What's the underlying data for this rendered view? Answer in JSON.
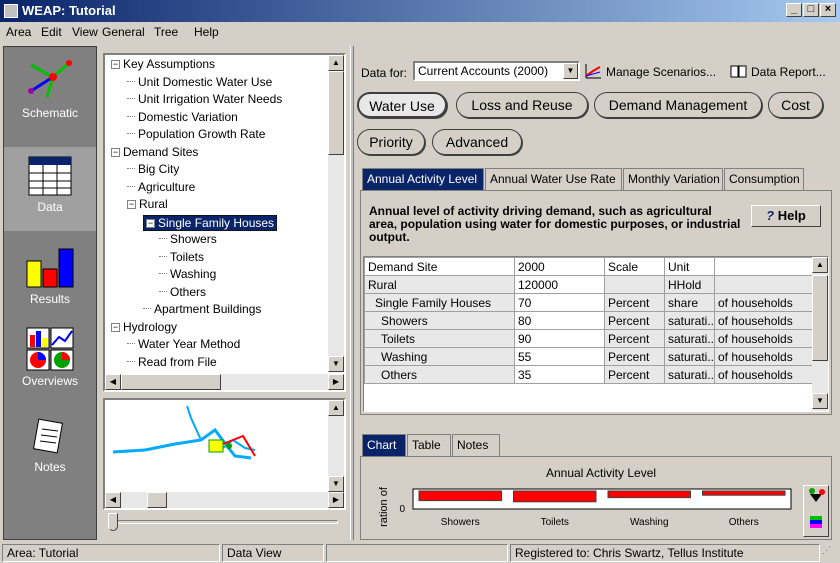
{
  "window": {
    "title": "WEAP: Tutorial"
  },
  "menu": [
    "Area",
    "Edit",
    "View",
    "General",
    "Tree",
    "Help"
  ],
  "nav": [
    {
      "label": "Schematic",
      "icon": "schematic-icon"
    },
    {
      "label": "Data",
      "icon": "data-icon"
    },
    {
      "label": "Results",
      "icon": "results-icon"
    },
    {
      "label": "Overviews",
      "icon": "overviews-icon"
    },
    {
      "label": "Notes",
      "icon": "notes-icon"
    }
  ],
  "tree": {
    "nodes": [
      {
        "label": "Key Assumptions",
        "expander": "−"
      },
      {
        "label": "Unit Domestic Water Use"
      },
      {
        "label": "Unit Irrigation Water Needs"
      },
      {
        "label": "Domestic Variation"
      },
      {
        "label": "Population Growth Rate"
      },
      {
        "label": "Demand Sites",
        "expander": "−"
      },
      {
        "label": "Big City"
      },
      {
        "label": "Agriculture"
      },
      {
        "label": "Rural",
        "expander": "−"
      },
      {
        "label": "Single Family Houses",
        "expander": "−",
        "selected": true
      },
      {
        "label": "Showers"
      },
      {
        "label": "Toilets"
      },
      {
        "label": "Washing"
      },
      {
        "label": "Others"
      },
      {
        "label": "Apartment Buildings"
      },
      {
        "label": "Hydrology",
        "expander": "−"
      },
      {
        "label": "Water Year Method"
      },
      {
        "label": "Read from File"
      }
    ]
  },
  "toolbar": {
    "data_for_label": "Data for:",
    "data_for_value": "Current Accounts (2000)",
    "manage_scenarios": "Manage Scenarios...",
    "data_report": "Data Report..."
  },
  "category_buttons": [
    "Water Use",
    "Loss and Reuse",
    "Demand Management",
    "Cost",
    "Priority",
    "Advanced"
  ],
  "tabs": [
    "Annual Activity Level",
    "Annual Water Use Rate",
    "Monthly Variation",
    "Consumption"
  ],
  "description": "Annual level of activity driving demand, such as agricultural area, population using water for domestic purposes, or industrial output.",
  "help_label": "Help",
  "table": {
    "headers": [
      "Demand Site",
      "2000",
      "Scale",
      "Unit",
      ""
    ],
    "rows": [
      [
        "Rural",
        "120000",
        "",
        "HHold",
        ""
      ],
      [
        "Single Family Houses",
        "70",
        "Percent",
        "share",
        "of households"
      ],
      [
        "Showers",
        "80",
        "Percent",
        "saturati...",
        "of households"
      ],
      [
        "Toilets",
        "90",
        "Percent",
        "saturati...",
        "of households"
      ],
      [
        "Washing",
        "55",
        "Percent",
        "saturati...",
        "of households"
      ],
      [
        "Others",
        "35",
        "Percent",
        "saturati...",
        "of households"
      ]
    ]
  },
  "lower_tabs": [
    "Chart",
    "Table",
    "Notes"
  ],
  "chart_data": {
    "type": "bar",
    "title": "Annual Activity Level",
    "ylabel": "ration of",
    "categories": [
      "Showers",
      "Toilets",
      "Washing",
      "Others"
    ],
    "values": [
      80,
      90,
      55,
      35
    ],
    "yticks": [
      "0"
    ],
    "color": "#ff0000"
  },
  "status": [
    "Area: Tutorial",
    "Data View",
    "",
    "Registered to: Chris Swartz, Tellus Institute"
  ]
}
